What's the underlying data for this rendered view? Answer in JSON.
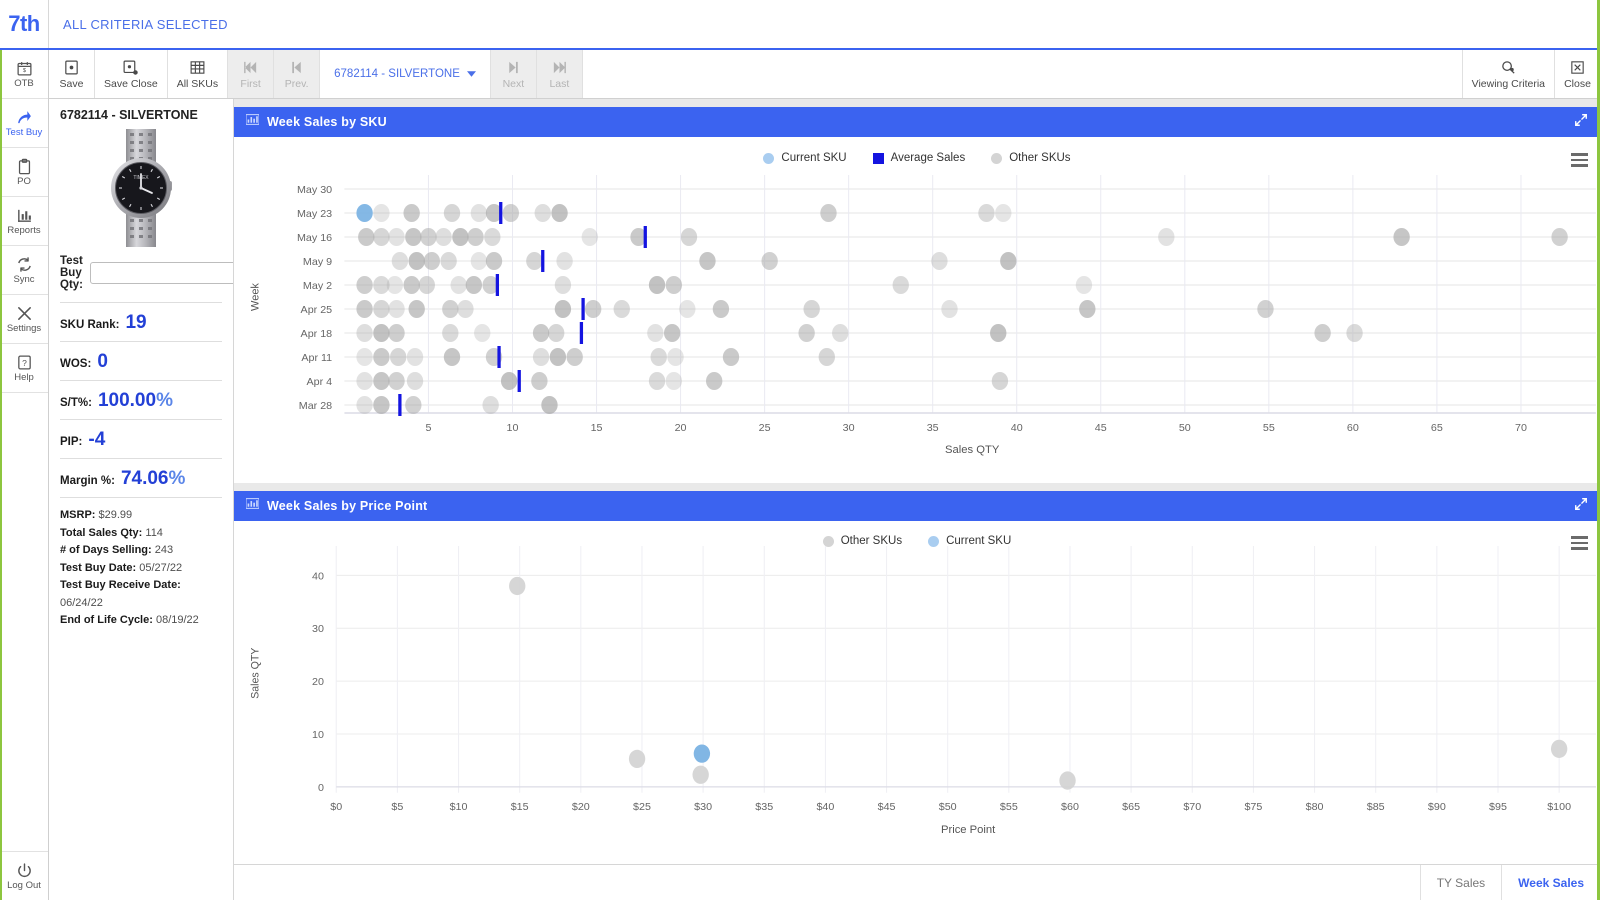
{
  "brand": {
    "logo": "7th",
    "criteria": "ALL CRITERIA SELECTED"
  },
  "rail": {
    "items": [
      {
        "label": "OTB",
        "icon": "calendar-icon",
        "active": false
      },
      {
        "label": "Test Buy",
        "icon": "arrow-curve-icon",
        "active": true
      },
      {
        "label": "PO",
        "icon": "clipboard-icon",
        "active": false
      },
      {
        "label": "Reports",
        "icon": "bar-chart-icon",
        "active": false
      },
      {
        "label": "Sync",
        "icon": "sync-icon",
        "active": false
      },
      {
        "label": "Settings",
        "icon": "tools-icon",
        "active": false
      },
      {
        "label": "Help",
        "icon": "help-icon",
        "active": false
      }
    ],
    "logout": {
      "label": "Log Out",
      "icon": "power-icon"
    }
  },
  "toolbar": {
    "save": "Save",
    "save_close": "Save Close",
    "all_skus": "All SKUs",
    "first": "First",
    "prev": "Prev.",
    "next": "Next",
    "last": "Last",
    "sku_selector": "6782114 - SILVERTONE",
    "viewing_criteria": "Viewing Criteria",
    "close": "Close"
  },
  "info": {
    "sku_title": "6782114 - SILVERTONE",
    "test_buy_qty_label": "Test Buy Qty:",
    "test_buy_qty_value": "",
    "test_buy_qty_placeholder": "",
    "stats": [
      {
        "key": "SKU Rank:",
        "value": "19",
        "suffix": ""
      },
      {
        "key": "WOS:",
        "value": "0",
        "suffix": ""
      },
      {
        "key": "S/T%:",
        "value": "100.00",
        "suffix": "%"
      },
      {
        "key": "PIP:",
        "value": "-4",
        "suffix": ""
      },
      {
        "key": "Margin %:",
        "value": "74.06",
        "suffix": "%"
      }
    ],
    "meta": [
      {
        "key": "MSRP:",
        "value": "$29.99"
      },
      {
        "key": "Total Sales Qty:",
        "value": "114"
      },
      {
        "key": "# of Days Selling:",
        "value": "243"
      },
      {
        "key": "Test Buy Date:",
        "value": "05/27/22"
      },
      {
        "key": "Test Buy Receive Date:",
        "value": "06/24/22"
      },
      {
        "key": "End of Life Cycle:",
        "value": "08/19/22"
      }
    ]
  },
  "colors": {
    "accent": "#3b63f0",
    "current_sku": "#a9cdf0",
    "average_sales": "#1414e0",
    "other_skus": "#c9c9c9",
    "value_blue": "#2340d6",
    "green_edge": "#8dc63f"
  },
  "panels": {
    "week_sales_by_sku": {
      "title": "Week Sales by SKU",
      "expand_icon": "expand-icon",
      "menu_icon": "hamburger-menu-icon"
    },
    "week_sales_by_price_point": {
      "title": "Week Sales by Price Point",
      "expand_icon": "expand-icon",
      "menu_icon": "hamburger-menu-icon"
    }
  },
  "bottom_tabs": [
    {
      "label": "TY Sales",
      "active": false
    },
    {
      "label": "Week Sales",
      "active": true
    }
  ],
  "chart_data": [
    {
      "type": "scatter",
      "title": "Week Sales by SKU",
      "xlabel": "Sales QTY",
      "ylabel": "Week",
      "xlim": [
        0,
        73
      ],
      "xticks": [
        5,
        10,
        15,
        20,
        25,
        30,
        35,
        40,
        45,
        50,
        55,
        60,
        65,
        70
      ],
      "categories": [
        "May 30",
        "May 23",
        "May 16",
        "May 9",
        "May 2",
        "Apr 25",
        "Apr 18",
        "Apr 11",
        "Apr 4",
        "Mar 28"
      ],
      "grid": true,
      "legend": [
        {
          "name": "Current SKU",
          "color": "#a9cdf0",
          "marker": "circle"
        },
        {
          "name": "Average Sales",
          "color": "#1414e0",
          "marker": "square"
        },
        {
          "name": "Other SKUs",
          "color": "#d4d4d4",
          "marker": "circle"
        }
      ],
      "series": [
        {
          "name": "Other SKUs",
          "color": "#c9c9c9",
          "points": [
            {
              "week": "May 23",
              "x": 2.2
            },
            {
              "week": "May 23",
              "x": 4.0
            },
            {
              "week": "May 23",
              "x": 6.4
            },
            {
              "week": "May 23",
              "x": 8.0
            },
            {
              "week": "May 23",
              "x": 8.9
            },
            {
              "week": "May 23",
              "x": 9.9
            },
            {
              "week": "May 23",
              "x": 11.8
            },
            {
              "week": "May 23",
              "x": 12.8
            },
            {
              "week": "May 23",
              "x": 28.8
            },
            {
              "week": "May 23",
              "x": 38.2
            },
            {
              "week": "May 23",
              "x": 39.2
            },
            {
              "week": "May 16",
              "x": 1.3
            },
            {
              "week": "May 16",
              "x": 2.2
            },
            {
              "week": "May 16",
              "x": 3.1
            },
            {
              "week": "May 16",
              "x": 4.1
            },
            {
              "week": "May 16",
              "x": 5.0
            },
            {
              "week": "May 16",
              "x": 5.9
            },
            {
              "week": "May 16",
              "x": 6.9
            },
            {
              "week": "May 16",
              "x": 7.8
            },
            {
              "week": "May 16",
              "x": 8.8
            },
            {
              "week": "May 16",
              "x": 14.6
            },
            {
              "week": "May 16",
              "x": 17.5
            },
            {
              "week": "May 16",
              "x": 20.5
            },
            {
              "week": "May 16",
              "x": 48.9
            },
            {
              "week": "May 16",
              "x": 62.9
            },
            {
              "week": "May 16",
              "x": 72.3
            },
            {
              "week": "May 9",
              "x": 3.3
            },
            {
              "week": "May 9",
              "x": 4.3
            },
            {
              "week": "May 9",
              "x": 5.2
            },
            {
              "week": "May 9",
              "x": 6.2
            },
            {
              "week": "May 9",
              "x": 8.0
            },
            {
              "week": "May 9",
              "x": 8.9
            },
            {
              "week": "May 9",
              "x": 11.3
            },
            {
              "week": "May 9",
              "x": 13.1
            },
            {
              "week": "May 9",
              "x": 21.6
            },
            {
              "week": "May 9",
              "x": 25.3
            },
            {
              "week": "May 9",
              "x": 35.4
            },
            {
              "week": "May 9",
              "x": 39.5
            },
            {
              "week": "May 2",
              "x": 1.2
            },
            {
              "week": "May 2",
              "x": 2.2
            },
            {
              "week": "May 2",
              "x": 3.0
            },
            {
              "week": "May 2",
              "x": 4.0
            },
            {
              "week": "May 2",
              "x": 4.9
            },
            {
              "week": "May 2",
              "x": 6.8
            },
            {
              "week": "May 2",
              "x": 7.7
            },
            {
              "week": "May 2",
              "x": 8.7
            },
            {
              "week": "May 2",
              "x": 13.0
            },
            {
              "week": "May 2",
              "x": 18.6
            },
            {
              "week": "May 2",
              "x": 19.6
            },
            {
              "week": "May 2",
              "x": 33.1
            },
            {
              "week": "May 2",
              "x": 44.0
            },
            {
              "week": "Apr 25",
              "x": 1.2
            },
            {
              "week": "Apr 25",
              "x": 2.2
            },
            {
              "week": "Apr 25",
              "x": 3.1
            },
            {
              "week": "Apr 25",
              "x": 4.3
            },
            {
              "week": "Apr 25",
              "x": 6.3
            },
            {
              "week": "Apr 25",
              "x": 7.2
            },
            {
              "week": "Apr 25",
              "x": 13.0
            },
            {
              "week": "Apr 25",
              "x": 14.8
            },
            {
              "week": "Apr 25",
              "x": 16.5
            },
            {
              "week": "Apr 25",
              "x": 20.4
            },
            {
              "week": "Apr 25",
              "x": 22.4
            },
            {
              "week": "Apr 25",
              "x": 27.8
            },
            {
              "week": "Apr 25",
              "x": 36.0
            },
            {
              "week": "Apr 25",
              "x": 44.2
            },
            {
              "week": "Apr 25",
              "x": 54.8
            },
            {
              "week": "Apr 18",
              "x": 1.2
            },
            {
              "week": "Apr 18",
              "x": 2.2
            },
            {
              "week": "Apr 18",
              "x": 3.1
            },
            {
              "week": "Apr 18",
              "x": 6.3
            },
            {
              "week": "Apr 18",
              "x": 8.2
            },
            {
              "week": "Apr 18",
              "x": 11.7
            },
            {
              "week": "Apr 18",
              "x": 12.6
            },
            {
              "week": "Apr 18",
              "x": 18.5
            },
            {
              "week": "Apr 18",
              "x": 19.5
            },
            {
              "week": "Apr 18",
              "x": 27.5
            },
            {
              "week": "Apr 18",
              "x": 29.5
            },
            {
              "week": "Apr 18",
              "x": 38.9
            },
            {
              "week": "Apr 18",
              "x": 58.2
            },
            {
              "week": "Apr 18",
              "x": 60.1
            },
            {
              "week": "Apr 11",
              "x": 1.2
            },
            {
              "week": "Apr 11",
              "x": 2.2
            },
            {
              "week": "Apr 11",
              "x": 3.2
            },
            {
              "week": "Apr 11",
              "x": 4.2
            },
            {
              "week": "Apr 11",
              "x": 6.4
            },
            {
              "week": "Apr 11",
              "x": 8.9
            },
            {
              "week": "Apr 11",
              "x": 11.7
            },
            {
              "week": "Apr 11",
              "x": 12.7
            },
            {
              "week": "Apr 11",
              "x": 13.7
            },
            {
              "week": "Apr 11",
              "x": 18.7
            },
            {
              "week": "Apr 11",
              "x": 19.7
            },
            {
              "week": "Apr 11",
              "x": 23.0
            },
            {
              "week": "Apr 11",
              "x": 28.7
            },
            {
              "week": "Apr 4",
              "x": 1.2
            },
            {
              "week": "Apr 4",
              "x": 2.2
            },
            {
              "week": "Apr 4",
              "x": 3.1
            },
            {
              "week": "Apr 4",
              "x": 4.2
            },
            {
              "week": "Apr 4",
              "x": 9.8
            },
            {
              "week": "Apr 4",
              "x": 11.6
            },
            {
              "week": "Apr 4",
              "x": 18.6
            },
            {
              "week": "Apr 4",
              "x": 19.6
            },
            {
              "week": "Apr 4",
              "x": 22.0
            },
            {
              "week": "Apr 4",
              "x": 39.0
            },
            {
              "week": "Mar 28",
              "x": 1.2
            },
            {
              "week": "Mar 28",
              "x": 2.2
            },
            {
              "week": "Mar 28",
              "x": 4.1
            },
            {
              "week": "Mar 28",
              "x": 8.7
            },
            {
              "week": "Mar 28",
              "x": 12.2
            }
          ]
        },
        {
          "name": "Current SKU",
          "color": "#77aee0",
          "points": [
            {
              "week": "May 23",
              "x": 1.2
            }
          ]
        },
        {
          "name": "Average Sales",
          "color": "#1414e0",
          "marker": "tick",
          "points": [
            {
              "week": "May 23",
              "x": 9.3
            },
            {
              "week": "May 16",
              "x": 17.9
            },
            {
              "week": "May 9",
              "x": 11.8
            },
            {
              "week": "May 2",
              "x": 9.1
            },
            {
              "week": "Apr 25",
              "x": 14.2
            },
            {
              "week": "Apr 18",
              "x": 14.1
            },
            {
              "week": "Apr 11",
              "x": 9.2
            },
            {
              "week": "Apr 4",
              "x": 10.4
            },
            {
              "week": "Mar 28",
              "x": 3.3
            }
          ]
        }
      ]
    },
    {
      "type": "scatter",
      "title": "Week Sales by Price Point",
      "xlabel": "Price Point",
      "ylabel": "Sales QTY",
      "xlim": [
        0,
        101
      ],
      "ylim": [
        0,
        43
      ],
      "xticks": [
        "$0",
        "$5",
        "$10",
        "$15",
        "$20",
        "$25",
        "$30",
        "$35",
        "$40",
        "$45",
        "$50",
        "$55",
        "$60",
        "$65",
        "$70",
        "$75",
        "$80",
        "$85",
        "$90",
        "$95",
        "$100"
      ],
      "yticks": [
        0,
        10,
        20,
        30,
        40
      ],
      "grid": true,
      "legend": [
        {
          "name": "Other SKUs",
          "color": "#d4d4d4",
          "marker": "circle"
        },
        {
          "name": "Current SKU",
          "color": "#a9cdf0",
          "marker": "circle"
        }
      ],
      "series": [
        {
          "name": "Other SKUs",
          "color": "#d2d2d2",
          "points": [
            {
              "x": 14.8,
              "y": 38
            },
            {
              "x": 24.6,
              "y": 5.3
            },
            {
              "x": 29.8,
              "y": 2.3
            },
            {
              "x": 59.8,
              "y": 1.2
            },
            {
              "x": 100.0,
              "y": 7.2
            }
          ]
        },
        {
          "name": "Current SKU",
          "color": "#77aee0",
          "points": [
            {
              "x": 29.9,
              "y": 6.3
            }
          ]
        }
      ]
    }
  ]
}
